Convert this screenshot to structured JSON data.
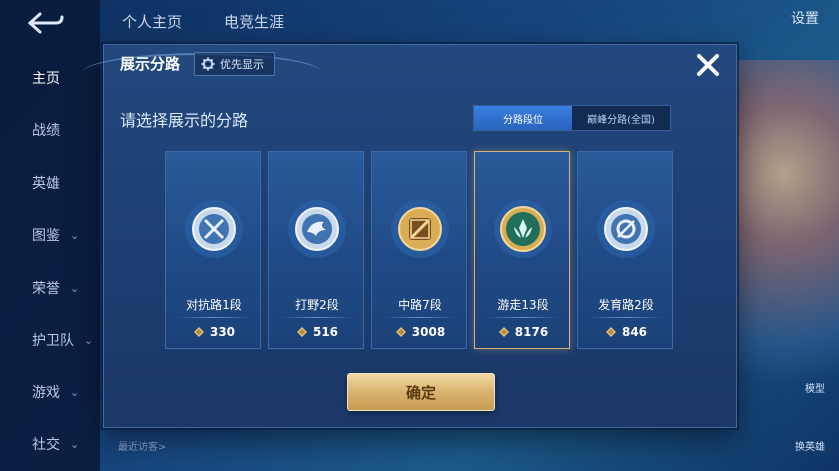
{
  "background": {
    "tabs": [
      "个人主页",
      "电竞生涯"
    ],
    "settings_label": "设置",
    "sidebar": [
      {
        "label": "主页",
        "has_chevron": false,
        "active": true
      },
      {
        "label": "战绩",
        "has_chevron": false
      },
      {
        "label": "英雄",
        "has_chevron": false
      },
      {
        "label": "图鉴",
        "has_chevron": true
      },
      {
        "label": "荣誉",
        "has_chevron": true
      },
      {
        "label": "护卫队",
        "has_chevron": true
      },
      {
        "label": "游戏",
        "has_chevron": true
      },
      {
        "label": "社交",
        "has_chevron": true
      }
    ],
    "recent_visitors": "最近访客>",
    "hint_top": "模型",
    "hint_bottom": "换英雄"
  },
  "dialog": {
    "title": "展示分路",
    "priority_label": "优先显示",
    "subtitle": "请选择展示的分路",
    "segments": [
      {
        "label": "分路段位",
        "active": true
      },
      {
        "label": "巅峰分路(全国)",
        "active": false
      }
    ],
    "lanes": [
      {
        "label": "对抗路1段",
        "points": "330",
        "selected": false,
        "icon": "sword-cross-badge-icon",
        "color": "#9cc4e8"
      },
      {
        "label": "打野2段",
        "points": "516",
        "selected": false,
        "icon": "dragon-badge-icon",
        "color": "#9cc4e8"
      },
      {
        "label": "中路7段",
        "points": "3008",
        "selected": false,
        "icon": "staff-badge-icon",
        "color": "#d8a84e"
      },
      {
        "label": "游走13段",
        "points": "8176",
        "selected": true,
        "icon": "shield-wings-badge-icon",
        "color": "#2e9e7e"
      },
      {
        "label": "发育路2段",
        "points": "846",
        "selected": false,
        "icon": "target-badge-icon",
        "color": "#9cc4e8"
      }
    ],
    "confirm_label": "确定"
  },
  "colors": {
    "accent_blue": "#2a63bf",
    "gold_button": "#d9b46f",
    "selected_border": "#d7b27a"
  }
}
